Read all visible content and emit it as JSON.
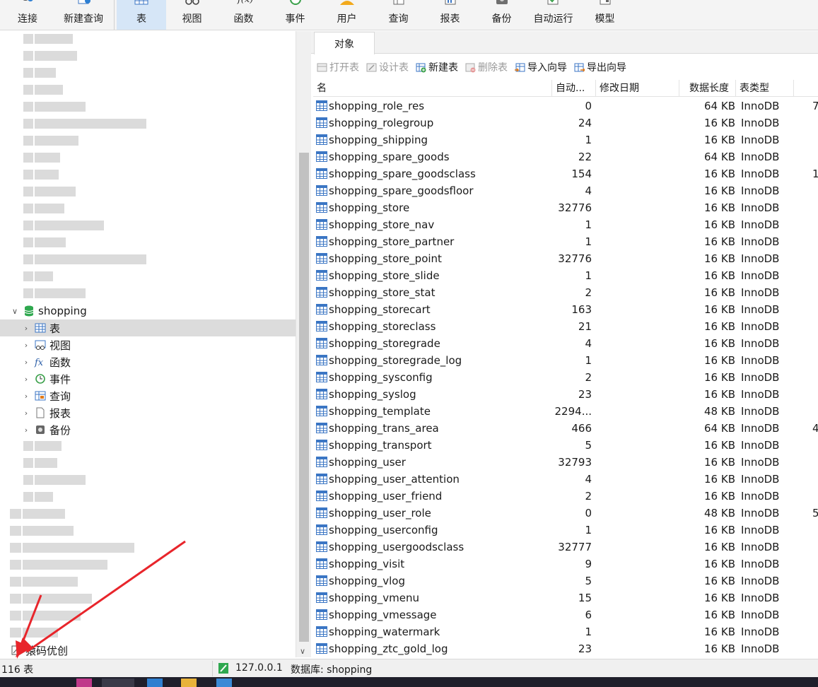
{
  "toolbar": {
    "items": [
      {
        "label": "连接",
        "icon": "connect-icon"
      },
      {
        "label": "新建查询",
        "icon": "new-query-icon"
      },
      {
        "label": "表",
        "icon": "table-icon",
        "active": true
      },
      {
        "label": "视图",
        "icon": "view-icon"
      },
      {
        "label": "函数",
        "icon": "function-icon"
      },
      {
        "label": "事件",
        "icon": "event-icon"
      },
      {
        "label": "用户",
        "icon": "user-icon"
      },
      {
        "label": "查询",
        "icon": "query-icon"
      },
      {
        "label": "报表",
        "icon": "report-icon"
      },
      {
        "label": "备份",
        "icon": "backup-icon"
      },
      {
        "label": "自动运行",
        "icon": "automation-icon"
      },
      {
        "label": "模型",
        "icon": "model-icon"
      }
    ]
  },
  "tree": {
    "database": "shopping",
    "children": [
      {
        "label": "表",
        "icon": "table-icon",
        "selected": true
      },
      {
        "label": "视图",
        "icon": "view-icon"
      },
      {
        "label": "函数",
        "icon": "function-icon"
      },
      {
        "label": "事件",
        "icon": "event-icon"
      },
      {
        "label": "查询",
        "icon": "query-icon"
      },
      {
        "label": "报表",
        "icon": "report-icon"
      },
      {
        "label": "备份",
        "icon": "backup-icon"
      }
    ],
    "bottom_connection": "猿码优创"
  },
  "tabs": {
    "objects": "对象"
  },
  "object_toolbar": {
    "open": "打开表",
    "design": "设计表",
    "new": "新建表",
    "delete": "删除表",
    "import": "导入向导",
    "export": "导出向导"
  },
  "grid": {
    "headers": {
      "name": "名",
      "auto": "自动...",
      "modified": "修改日期",
      "size": "数据长度",
      "type": "表类型"
    },
    "rows": [
      {
        "name": "shopping_role_res",
        "auto": "0",
        "size": "64 KB",
        "type": "InnoDB",
        "extra": "7"
      },
      {
        "name": "shopping_rolegroup",
        "auto": "24",
        "size": "16 KB",
        "type": "InnoDB",
        "extra": ""
      },
      {
        "name": "shopping_shipping",
        "auto": "1",
        "size": "16 KB",
        "type": "InnoDB",
        "extra": ""
      },
      {
        "name": "shopping_spare_goods",
        "auto": "22",
        "size": "64 KB",
        "type": "InnoDB",
        "extra": ""
      },
      {
        "name": "shopping_spare_goodsclass",
        "auto": "154",
        "size": "16 KB",
        "type": "InnoDB",
        "extra": "1"
      },
      {
        "name": "shopping_spare_goodsfloor",
        "auto": "4",
        "size": "16 KB",
        "type": "InnoDB",
        "extra": ""
      },
      {
        "name": "shopping_store",
        "auto": "32776",
        "size": "16 KB",
        "type": "InnoDB",
        "extra": ""
      },
      {
        "name": "shopping_store_nav",
        "auto": "1",
        "size": "16 KB",
        "type": "InnoDB",
        "extra": ""
      },
      {
        "name": "shopping_store_partner",
        "auto": "1",
        "size": "16 KB",
        "type": "InnoDB",
        "extra": ""
      },
      {
        "name": "shopping_store_point",
        "auto": "32776",
        "size": "16 KB",
        "type": "InnoDB",
        "extra": ""
      },
      {
        "name": "shopping_store_slide",
        "auto": "1",
        "size": "16 KB",
        "type": "InnoDB",
        "extra": ""
      },
      {
        "name": "shopping_store_stat",
        "auto": "2",
        "size": "16 KB",
        "type": "InnoDB",
        "extra": ""
      },
      {
        "name": "shopping_storecart",
        "auto": "163",
        "size": "16 KB",
        "type": "InnoDB",
        "extra": ""
      },
      {
        "name": "shopping_storeclass",
        "auto": "21",
        "size": "16 KB",
        "type": "InnoDB",
        "extra": ""
      },
      {
        "name": "shopping_storegrade",
        "auto": "4",
        "size": "16 KB",
        "type": "InnoDB",
        "extra": ""
      },
      {
        "name": "shopping_storegrade_log",
        "auto": "1",
        "size": "16 KB",
        "type": "InnoDB",
        "extra": ""
      },
      {
        "name": "shopping_sysconfig",
        "auto": "2",
        "size": "16 KB",
        "type": "InnoDB",
        "extra": ""
      },
      {
        "name": "shopping_syslog",
        "auto": "23",
        "size": "16 KB",
        "type": "InnoDB",
        "extra": ""
      },
      {
        "name": "shopping_template",
        "auto": "2294...",
        "size": "48 KB",
        "type": "InnoDB",
        "extra": ""
      },
      {
        "name": "shopping_trans_area",
        "auto": "466",
        "size": "64 KB",
        "type": "InnoDB",
        "extra": "4"
      },
      {
        "name": "shopping_transport",
        "auto": "5",
        "size": "16 KB",
        "type": "InnoDB",
        "extra": ""
      },
      {
        "name": "shopping_user",
        "auto": "32793",
        "size": "16 KB",
        "type": "InnoDB",
        "extra": ""
      },
      {
        "name": "shopping_user_attention",
        "auto": "4",
        "size": "16 KB",
        "type": "InnoDB",
        "extra": ""
      },
      {
        "name": "shopping_user_friend",
        "auto": "2",
        "size": "16 KB",
        "type": "InnoDB",
        "extra": ""
      },
      {
        "name": "shopping_user_role",
        "auto": "0",
        "size": "48 KB",
        "type": "InnoDB",
        "extra": "5"
      },
      {
        "name": "shopping_userconfig",
        "auto": "1",
        "size": "16 KB",
        "type": "InnoDB",
        "extra": ""
      },
      {
        "name": "shopping_usergoodsclass",
        "auto": "32777",
        "size": "16 KB",
        "type": "InnoDB",
        "extra": ""
      },
      {
        "name": "shopping_visit",
        "auto": "9",
        "size": "16 KB",
        "type": "InnoDB",
        "extra": ""
      },
      {
        "name": "shopping_vlog",
        "auto": "5",
        "size": "16 KB",
        "type": "InnoDB",
        "extra": ""
      },
      {
        "name": "shopping_vmenu",
        "auto": "15",
        "size": "16 KB",
        "type": "InnoDB",
        "extra": ""
      },
      {
        "name": "shopping_vmessage",
        "auto": "6",
        "size": "16 KB",
        "type": "InnoDB",
        "extra": ""
      },
      {
        "name": "shopping_watermark",
        "auto": "1",
        "size": "16 KB",
        "type": "InnoDB",
        "extra": ""
      },
      {
        "name": "shopping_ztc_gold_log",
        "auto": "23",
        "size": "16 KB",
        "type": "InnoDB",
        "extra": ""
      }
    ]
  },
  "status": {
    "table_count": "116 表",
    "host": "127.0.0.1",
    "database": "数据库: shopping"
  },
  "colors": {
    "accent": "#1f6fc5",
    "active_tab": "#d6e6f7",
    "annotation_arrow": "#e8252b",
    "db_icon": "#2fa84f"
  }
}
